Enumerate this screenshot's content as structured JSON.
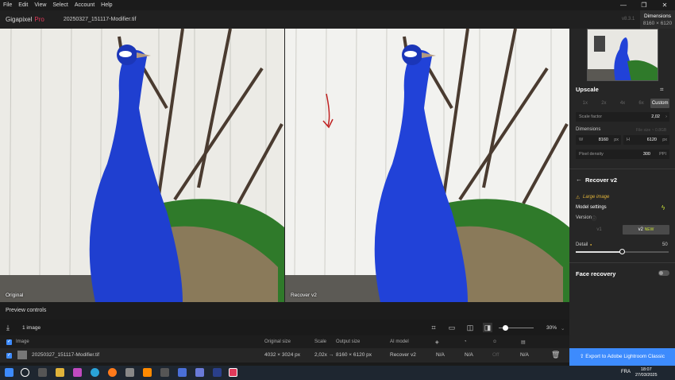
{
  "menu": {
    "file": "File",
    "edit": "Edit",
    "view": "View",
    "select": "Select",
    "account": "Account",
    "help": "Help"
  },
  "window": {
    "minimize": "—",
    "maximize": "❐",
    "close": "✕"
  },
  "topbar": {
    "brand": "Gigapixel",
    "brand_suffix": "Pro",
    "filename": "20250327_151117-Modifier.tif",
    "version": "v8.3.1"
  },
  "dimensions": {
    "title": "Dimensions",
    "value": "8160 × 6120"
  },
  "viewer": {
    "left_label": "Original",
    "right_label": "Recover v2"
  },
  "preview": {
    "label": "Preview controls"
  },
  "toolbar": {
    "count": "1 image",
    "zoom": "30%"
  },
  "table": {
    "headers": {
      "image": "Image",
      "original_size": "Original size",
      "scale": "Scale",
      "output_size": "Output size",
      "ai_model": "AI model"
    },
    "row": {
      "name": "20250327_151117-Modifier.tif",
      "original_size": "4032 × 3024 px",
      "scale": "2,02x →",
      "output_size": "8160 × 6120 px",
      "ai_model": "Recover v2",
      "c1": "N/A",
      "c2": "N/A",
      "c3": "Off",
      "c4": "N/A"
    }
  },
  "side": {
    "upscale_title": "Upscale",
    "scales": [
      "1x",
      "2x",
      "4x",
      "6x",
      "Custom"
    ],
    "scale_factor_label": "Scale factor",
    "scale_factor": "2,02",
    "dimensions_label": "Dimensions",
    "file_size": "File size ~ 0.8GB",
    "w_label": "W",
    "w_value": "8160",
    "w_unit": "px",
    "h_label": "H",
    "h_value": "6120",
    "h_unit": "px",
    "density_label": "Pixel density",
    "density_value": "300",
    "density_unit": "PPI",
    "model_title": "Recover v2",
    "large_image": "Large image",
    "model_settings": "Model settings",
    "version_label": "Version",
    "v1": "v1",
    "v2": "v2",
    "new": "NEW",
    "detail_label": "Detail",
    "detail_value": "50",
    "face_recovery": "Face recovery"
  },
  "export": {
    "label": "Export to Adobe Lightroom Classic"
  },
  "taskbar": {
    "time": "18:07",
    "date": "27/03/2025",
    "lang": "FRA"
  },
  "colors": {
    "accent": "#3d8bfd",
    "brand": "#e03a5a",
    "highlight": "#e0b33a"
  }
}
